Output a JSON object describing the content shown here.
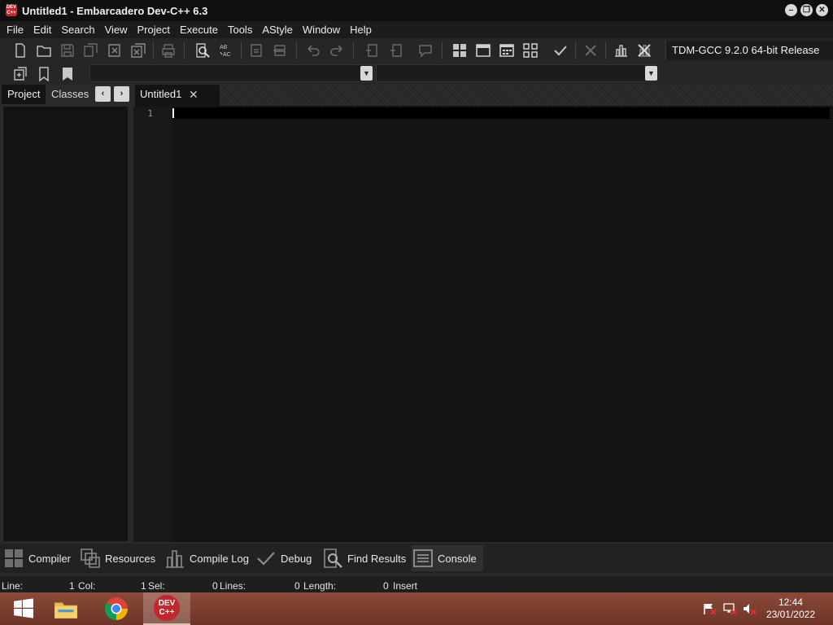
{
  "window": {
    "title": "Untitled1 - Embarcadero Dev-C++ 6.3",
    "logo_text_top": "DEV",
    "logo_text_bottom": "C++",
    "minimize": "–",
    "restore": "❐",
    "close": "✕"
  },
  "menu": [
    "File",
    "Edit",
    "Search",
    "View",
    "Project",
    "Execute",
    "Tools",
    "AStyle",
    "Window",
    "Help"
  ],
  "toolbar": {
    "compiler": "TDM-GCC 9.2.0 64-bit Release"
  },
  "left_panel": {
    "tabs": [
      "Project",
      "Classes"
    ],
    "prev": "‹",
    "next": "›"
  },
  "editor": {
    "tab_label": "Untitled1",
    "tab_close": "✕",
    "line_numbers": [
      "1"
    ]
  },
  "bottom_tabs": [
    "Compiler",
    "Resources",
    "Compile Log",
    "Debug",
    "Find Results",
    "Console"
  ],
  "status": {
    "line_label": "Line:",
    "line_val": "1",
    "col_label": "Col:",
    "col_val": "1",
    "sel_label": "Sel:",
    "sel_val": "0",
    "lines_label": "Lines:",
    "lines_val": "0",
    "length_label": "Length:",
    "length_val": "0",
    "mode": "Insert"
  },
  "taskbar": {
    "devcpp_top": "DEV",
    "devcpp_bottom": "C++",
    "time": "12:44",
    "date": "23/01/2022"
  },
  "colors": {
    "accent": "#c0282d",
    "editor_bg": "#141414",
    "taskbar": "#7a3d2f"
  },
  "icons": [
    "new-file-icon",
    "open-icon",
    "save-icon",
    "save-all-icon",
    "close-icon",
    "close-all-icon",
    "print-icon",
    "find-icon",
    "replace-icon",
    "indent-icon",
    "unindent-icon",
    "undo-icon",
    "redo-icon",
    "compile-icon",
    "run-icon",
    "debug-icon",
    "check-icon",
    "stop-icon",
    "chart-icon"
  ]
}
